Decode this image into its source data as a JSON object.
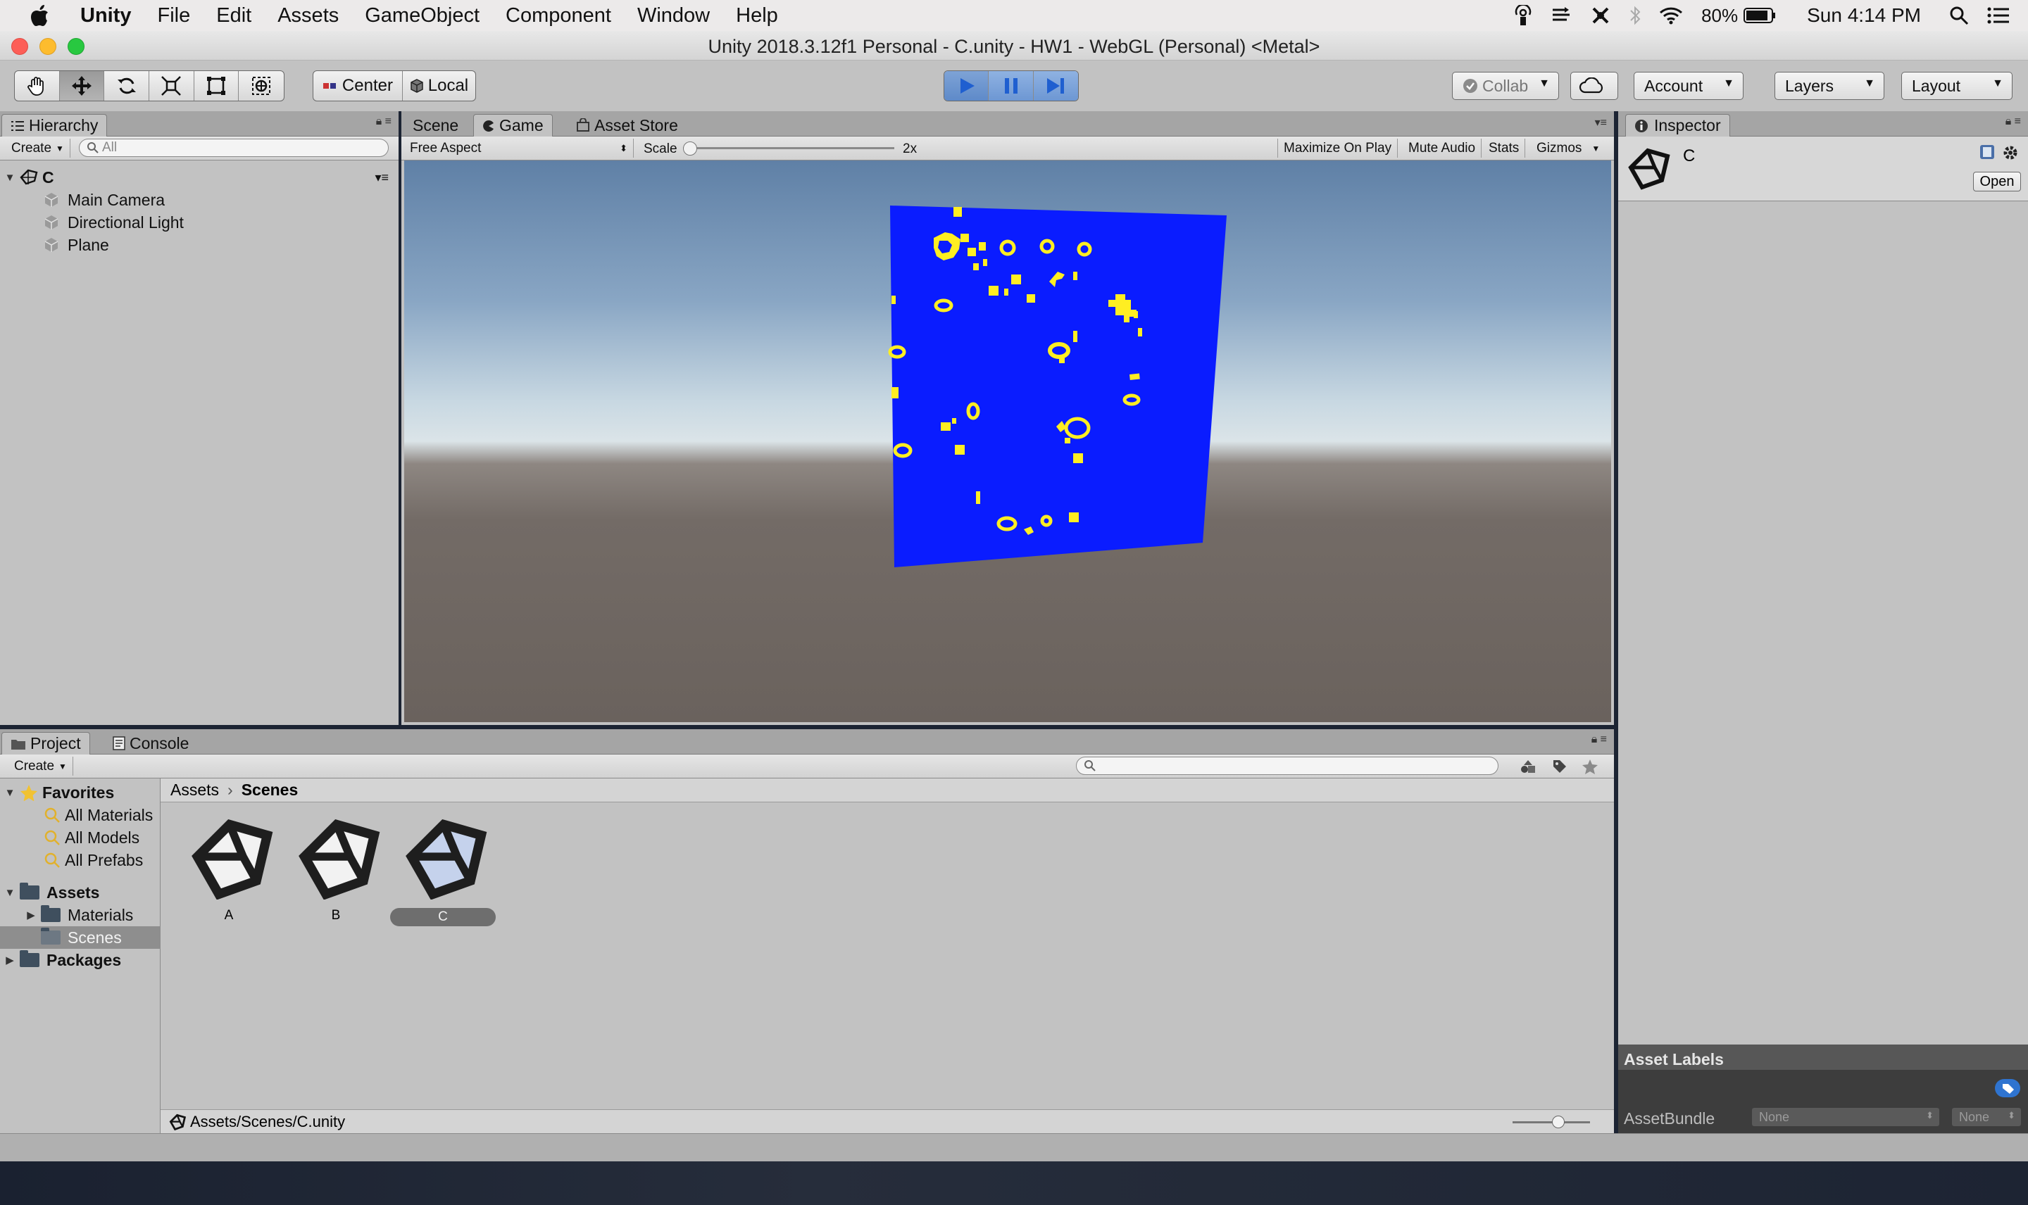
{
  "menubar": {
    "app": "Unity",
    "items": [
      "File",
      "Edit",
      "Assets",
      "GameObject",
      "Component",
      "Window",
      "Help"
    ],
    "battery": "80%",
    "clock": "Sun 4:14 PM"
  },
  "window": {
    "title": "Unity 2018.3.12f1 Personal - C.unity - HW1 - WebGL (Personal) <Metal>"
  },
  "toolbar": {
    "center_label": "Center",
    "local_label": "Local",
    "collab_label": "Collab",
    "account_label": "Account",
    "layers_label": "Layers",
    "layout_label": "Layout"
  },
  "hierarchy": {
    "tab": "Hierarchy",
    "create_label": "Create",
    "search_placeholder": "All",
    "scene_name": "C",
    "items": [
      "Main Camera",
      "Directional Light",
      "Plane"
    ]
  },
  "center_tabs": {
    "scene": "Scene",
    "game": "Game",
    "asset_store": "Asset Store"
  },
  "game_view": {
    "aspect": "Free Aspect",
    "scale_label": "Scale",
    "scale_value": "2x",
    "scale_fraction": 0,
    "maximize": "Maximize On Play",
    "mute": "Mute Audio",
    "stats": "Stats",
    "gizmos": "Gizmos"
  },
  "inspector": {
    "tab": "Inspector",
    "asset_name": "C",
    "open_label": "Open",
    "asset_labels": "Asset Labels",
    "assetbundle_label": "AssetBundle",
    "bundle_value": "None",
    "variant_value": "None"
  },
  "project": {
    "tab_project": "Project",
    "tab_console": "Console",
    "create_label": "Create",
    "favorites_label": "Favorites",
    "favorites": [
      "All Materials",
      "All Models",
      "All Prefabs"
    ],
    "assets_label": "Assets",
    "asset_folders": [
      "Materials",
      "Scenes"
    ],
    "packages_label": "Packages",
    "breadcrumb_root": "Assets",
    "breadcrumb_current": "Scenes",
    "files": [
      "A",
      "B",
      "C"
    ],
    "selected_file": "C",
    "status_path": "Assets/Scenes/C.unity"
  },
  "colors": {
    "plane_blue": "#0a1cff",
    "cell_yellow": "#ffee22",
    "play_active": "#6a93cf"
  }
}
